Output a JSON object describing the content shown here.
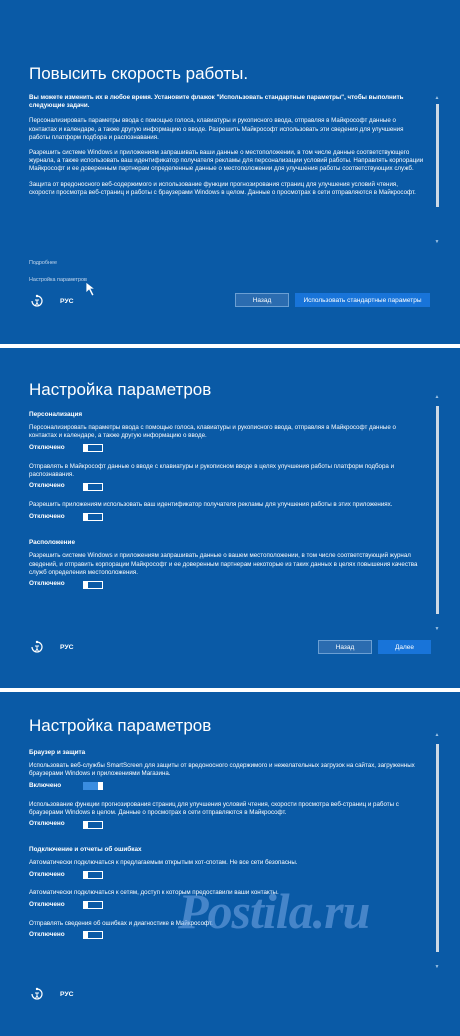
{
  "panel1": {
    "title": "Повысить скорость работы.",
    "intro": "Вы можете изменить их в любое время. Установите флажок \"Использовать стандартные параметры\", чтобы выполнить следующие задачи.",
    "paragraphs": [
      "Персонализировать параметры ввода с помощью голоса, клавиатуры и рукописного ввода, отправляя в Майкрософт данные о контактах и календаре, а также другую информацию о вводе. Разрешить Майкрософт использовать эти сведения для улучшения работы платформ подбора и распознавания.",
      "Разрешить системе Windows и приложениям запрашивать ваши данные о местоположении, в том числе данные соответствующего журнала, а также использовать ваш идентификатор получателя рекламы для персонализации условий работы. Направлять корпорации Майкрософт и ее доверенным партнерам определенные данные о местоположении для улучшения работы соответствующих служб.",
      "Защита от вредоносного веб-содержимого и использование функции прогнозирования страниц для улучшения условий чтения, скорости просмотра веб-страниц и работы с браузерами Windows в целом. Данные о просмотрах в сети отправляются в Майкрософт."
    ],
    "more_link": "Подробнее",
    "customize_link": "Настройка параметров",
    "lang": "РУС",
    "back_button": "Назад",
    "express_button": "Использовать стандартные параметры"
  },
  "panel2": {
    "title": "Настройка параметров",
    "section1": "Персонализация",
    "items1": [
      {
        "text": "Персонализировать параметры ввода с помощью голоса, клавиатуры и рукописного ввода, отправляя в Майкрософт данные о контактах и календаре, а также другую информацию о вводе.",
        "state": "Отключено"
      },
      {
        "text": "Отправлять в Майкрософт данные о вводе с клавиатуры и рукописном вводе в целях улучшения работы платформ подбора и распознавания.",
        "state": "Отключено"
      },
      {
        "text": "Разрешить приложениям использовать ваш идентификатор получателя рекламы для улучшения работы в этих приложениях.",
        "state": "Отключено"
      }
    ],
    "section2": "Расположение",
    "items2": [
      {
        "text": "Разрешить системе Windows и приложениям запрашивать данные о вашем местоположении, в том числе соответствующий журнал сведений, и отправить корпорации Майкрософт и ее доверенным партнерам некоторые из таких данных в целях повышения качества служб определения местоположения.",
        "state": "Отключено"
      }
    ],
    "lang": "РУС",
    "back_button": "Назад",
    "next_button": "Далее"
  },
  "panel3": {
    "title": "Настройка параметров",
    "section1": "Браузер и защита",
    "items1": [
      {
        "text": "Использовать веб-службы SmartScreen для защиты от вредоносного содержимого и нежелательных загрузок на сайтах, загруженных браузерами Windows и приложениями Магазина.",
        "state": "Включено",
        "on": true
      },
      {
        "text": "Использование функции прогнозирования страниц для улучшения условий чтения, скорости просмотра веб-страниц и работы с браузерами Windows в целом. Данные о просмотрах в сети отправляются в Майкрософт.",
        "state": "Отключено",
        "on": false
      }
    ],
    "section2": "Подключение и отчеты об ошибках",
    "items2": [
      {
        "text": "Автоматически подключаться к предлагаемым открытым хот-спотам. Не все сети безопасны.",
        "state": "Отключено"
      },
      {
        "text": "Автоматически подключаться к сетям, доступ к которым предоставили ваши контакты.",
        "state": "Отключено"
      },
      {
        "text": "Отправлять сведения об ошибках и диагностике в Майкрософт.",
        "state": "Отключено"
      }
    ],
    "lang": "РУС"
  },
  "watermark": "Postila.ru",
  "colors": {
    "panel_bg": "#0a5aa6",
    "primary_button": "#1874d9",
    "toggle_on": "#3a8de0"
  },
  "icons": {
    "ease_of_access": "ease-of-access-icon",
    "cursor": "mouse-pointer-icon"
  }
}
